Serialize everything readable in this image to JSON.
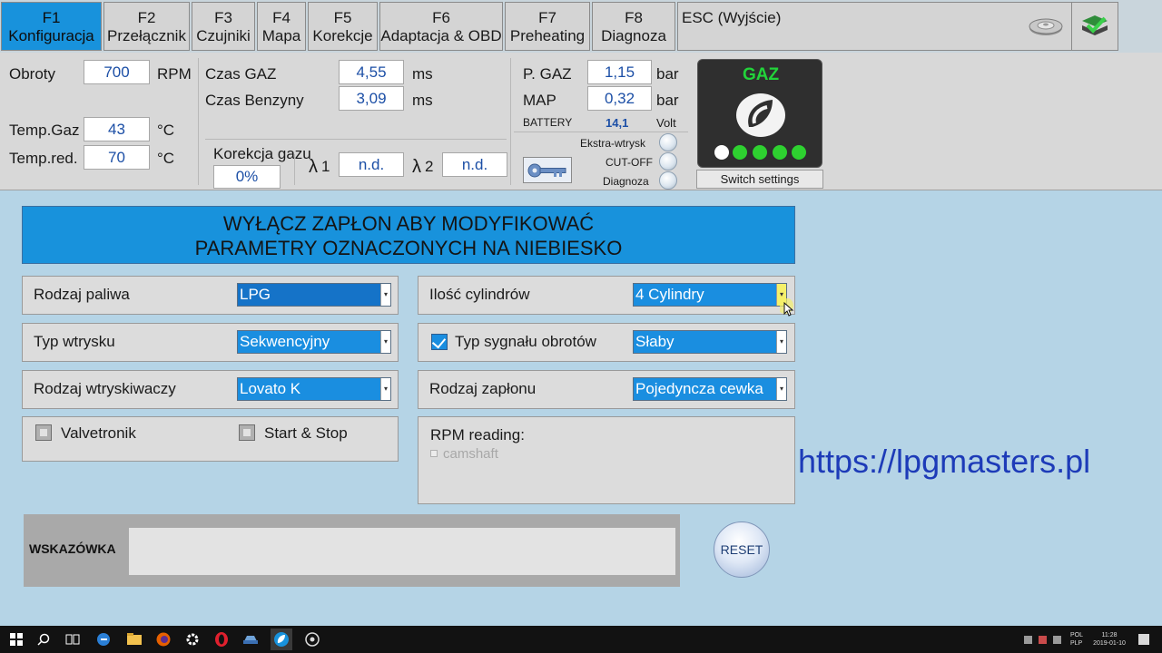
{
  "tabs": [
    {
      "key": "F1",
      "label": "Konfiguracja"
    },
    {
      "key": "F2",
      "label": "Przełącznik"
    },
    {
      "key": "F3",
      "label": "Czujniki"
    },
    {
      "key": "F4",
      "label": "Mapa"
    },
    {
      "key": "F5",
      "label": "Korekcje"
    },
    {
      "key": "F6",
      "label": "Adaptacja & OBD"
    },
    {
      "key": "F7",
      "label": "Preheating"
    },
    {
      "key": "F8",
      "label": "Diagnoza"
    }
  ],
  "esc_label": "ESC (Wyjście)",
  "status": {
    "obroty": {
      "label": "Obroty",
      "value": "700",
      "unit": "RPM"
    },
    "temp_gaz": {
      "label": "Temp.Gaz",
      "value": "43",
      "unit": "°C"
    },
    "temp_red": {
      "label": "Temp.red.",
      "value": "70",
      "unit": "°C"
    },
    "czas_gaz": {
      "label": "Czas GAZ",
      "value": "4,55",
      "unit": "ms"
    },
    "czas_benzyny": {
      "label": "Czas Benzyny",
      "value": "3,09",
      "unit": "ms"
    },
    "korekcja": {
      "label": "Korekcja gazu",
      "value": "0%"
    },
    "lambda1": {
      "symbol": "λ",
      "num": "1",
      "value": "n.d."
    },
    "lambda2": {
      "symbol": "λ",
      "num": "2",
      "value": "n.d."
    },
    "p_gaz": {
      "label": "P. GAZ",
      "value": "1,15",
      "unit": "bar"
    },
    "map": {
      "label": "MAP",
      "value": "0,32",
      "unit": "bar"
    },
    "battery": {
      "label": "BATTERY",
      "value": "14,1",
      "unit": "Volt"
    },
    "indicators": [
      "Ekstra-wtrysk",
      "CUT-OFF",
      "Diagnoza"
    ],
    "gaz_title": "GAZ",
    "switch_settings": "Switch settings"
  },
  "banner": {
    "line1": "WYŁĄCZ ZAPŁON ABY MODYFIKOWAĆ",
    "line2": "PARAMETRY OZNACZONYCH NA NIEBIESKO"
  },
  "left_fields": [
    {
      "label": "Rodzaj paliwa",
      "value": "LPG"
    },
    {
      "label": "Typ wtrysku",
      "value": "Sekwencyjny"
    },
    {
      "label": "Rodzaj wtryskiwaczy",
      "value": "Lovato K"
    }
  ],
  "right_fields": [
    {
      "label": "Ilość cylindrów",
      "value": "4 Cylindry"
    },
    {
      "label": "Typ sygnału obrotów",
      "value": "Słaby"
    },
    {
      "label": "Rodzaj zapłonu",
      "value": "Pojedyncza cewka"
    }
  ],
  "checkboxes": {
    "valvetronik": "Valvetronik",
    "start_stop": "Start & Stop"
  },
  "rpm_reading": {
    "title": "RPM reading:",
    "option": "camshaft"
  },
  "url": "https://lpgmasters.pl",
  "hint_label": "WSKAZÓWKA",
  "reset_label": "RESET",
  "taskbar": {
    "lang1": "POL",
    "lang2": "PLP",
    "time": "11:28",
    "date": "2019-01-10"
  },
  "colors": {
    "accent": "#1892dc",
    "background": "#b5d4e6",
    "indicator": "#2ed130",
    "url": "#1d3bb8"
  }
}
